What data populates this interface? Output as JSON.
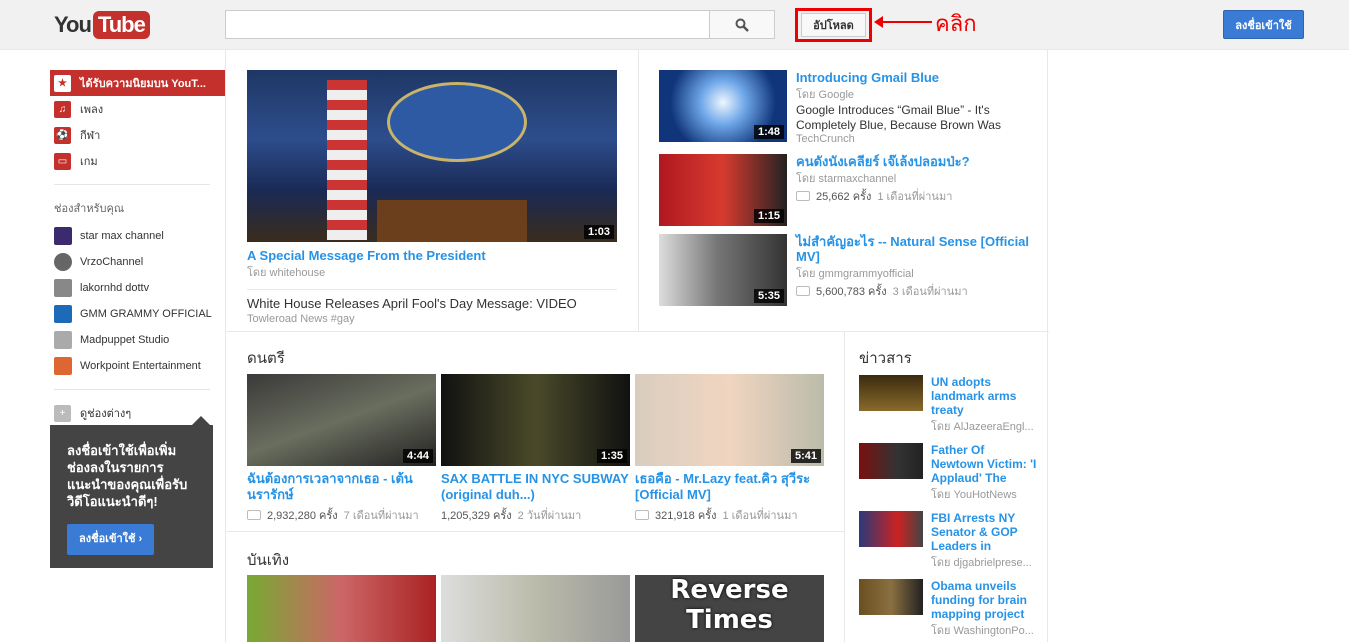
{
  "header": {
    "logo_you": "You",
    "logo_tube": "Tube",
    "search_placeholder": "",
    "upload_label": "อัปโหลด",
    "annotation": "คลิก",
    "signin_label": "ลงชื่อเข้าใช้"
  },
  "guide": {
    "items": [
      {
        "label": "ได้รับความนิยมบน YouT...",
        "icon": "popular-icon"
      },
      {
        "label": "เพลง",
        "icon": "music-icon"
      },
      {
        "label": "กีฬา",
        "icon": "sports-icon"
      },
      {
        "label": "เกม",
        "icon": "gaming-icon"
      }
    ],
    "channels_heading": "ช่องสำหรับคุณ",
    "channels": [
      "star max channel",
      "VrzoChannel",
      "lakornhd dottv",
      "GMM GRAMMY OFFICIAL",
      "Madpuppet Studio",
      "Workpoint Entertainment"
    ],
    "browse_label": "ดูช่องต่างๆ",
    "promo_text": "ลงชื่อเข้าใช้เพื่อเพิ่มช่องลงในรายการแนะนำของคุณเพื่อรับวิดีโอแนะนำดีๆ!",
    "promo_button": "ลงชื่อเข้าใช้ ›"
  },
  "hero": {
    "duration": "1:03",
    "title": "A Special Message From the President",
    "by": "โดย whitehouse",
    "related_title": "White House Releases April Fool's Day Message: VIDEO",
    "related_source": "Towleroad News #gay"
  },
  "side_videos": [
    {
      "title": "Introducing Gmail Blue",
      "by": "โดย Google",
      "desc": "Google Introduces “Gmail Blue” - It's Completely Blue, Because Brown Was",
      "source": "TechCrunch",
      "duration": "1:48"
    },
    {
      "title": "คนดังนังเคลียร์ เจ๊เล้งปลอมป่ะ?",
      "by": "โดย starmaxchannel",
      "views": "25,662 ครั้ง",
      "age": "1 เดือนที่ผ่านมา",
      "duration": "1:15"
    },
    {
      "title": "ไม่สำคัญอะไร -- Natural Sense [Official MV]",
      "by": "โดย gmmgrammyofficial",
      "views": "5,600,783 ครั้ง",
      "age": "3 เดือนที่ผ่านมา",
      "duration": "5:35"
    }
  ],
  "music": {
    "heading": "ดนตรี",
    "videos": [
      {
        "title": "ฉันต้องการเวลาจากเธอ - เต้น นรารักษ์",
        "views": "2,932,280 ครั้ง",
        "age": "7 เดือนที่ผ่านมา",
        "duration": "4:44"
      },
      {
        "title": "SAX BATTLE IN NYC SUBWAY (original duh...)",
        "views": "1,205,329 ครั้ง",
        "age": "2 วันที่ผ่านมา",
        "duration": "1:35"
      },
      {
        "title": "เธอคือ - Mr.Lazy feat.คิว สุวีระ [Official MV]",
        "views": "321,918 ครั้ง",
        "age": "1 เดือนที่ผ่านมา",
        "duration": "5:41"
      }
    ]
  },
  "entertainment": {
    "heading": "บันเทิง",
    "thumb3_text1": "Reverse",
    "thumb3_text2": "Times"
  },
  "news": {
    "heading": "ข่าวสาร",
    "items": [
      {
        "title": "UN adopts landmark arms treaty",
        "by": "โดย AlJazeeraEngl..."
      },
      {
        "title": "Father Of Newtown Victim: 'I Applaud' The",
        "by": "โดย YouHotNews"
      },
      {
        "title": "FBI Arrests NY Senator & GOP Leaders in",
        "by": "โดย djgabrielprese..."
      },
      {
        "title": "Obama unveils funding for brain mapping project",
        "by": "โดย WashingtonPo..."
      }
    ]
  },
  "colors": {
    "brand": "#c4302b",
    "link": "#2793e6",
    "annotation": "#ee0000",
    "signin": "#3a7bd5"
  }
}
